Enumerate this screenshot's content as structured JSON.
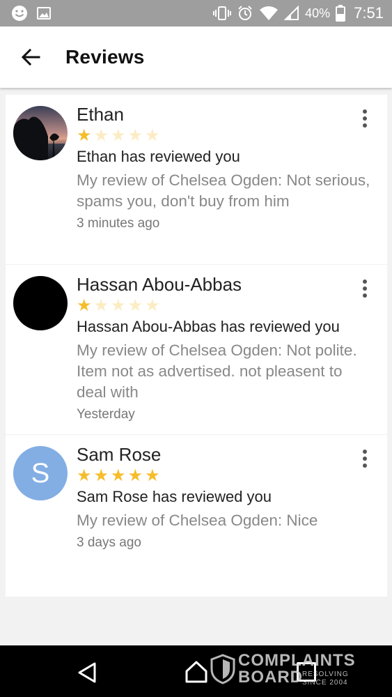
{
  "status_bar": {
    "battery_percent": "40%",
    "time": "7:51",
    "icons": [
      "smiley-notification-icon",
      "image-notification-icon",
      "vibrate-icon",
      "alarm-icon",
      "wifi-icon",
      "signal-icon",
      "battery-icon"
    ]
  },
  "app_bar": {
    "title": "Reviews",
    "back_icon": "arrow-back-icon"
  },
  "colors": {
    "status_bar_bg": "#9e9e9e",
    "star_filled": "#f5bd2b",
    "star_empty": "#fcecc4",
    "avatar_letter_bg": "#82aee4"
  },
  "reviews": [
    {
      "name": "Ethan",
      "rating": 1,
      "max_rating": 5,
      "headline": "Ethan has reviewed you",
      "body": "My review of Chelsea Ogden: Not serious, spams you, don't buy from him",
      "time": "3 minutes ago",
      "avatar": "sunset-photo"
    },
    {
      "name": "Hassan Abou-Abbas",
      "rating": 1,
      "max_rating": 5,
      "headline": "Hassan Abou-Abbas has reviewed you",
      "body": "My review of Chelsea Ogden: Not polite. Item not as advertised. not pleasent to deal with",
      "time": "Yesterday",
      "avatar": "black-photo"
    },
    {
      "name": "Sam Rose",
      "rating": 5,
      "max_rating": 5,
      "headline": "Sam Rose has reviewed you",
      "body": "My review of Chelsea Ogden: Nice",
      "time": "3 days ago",
      "avatar_letter": "S"
    }
  ],
  "watermark": {
    "line1": "COMPLAINTS",
    "line2": "BOARD",
    "sub1": "RESOLVING",
    "sub2": "SINCE 2004"
  }
}
